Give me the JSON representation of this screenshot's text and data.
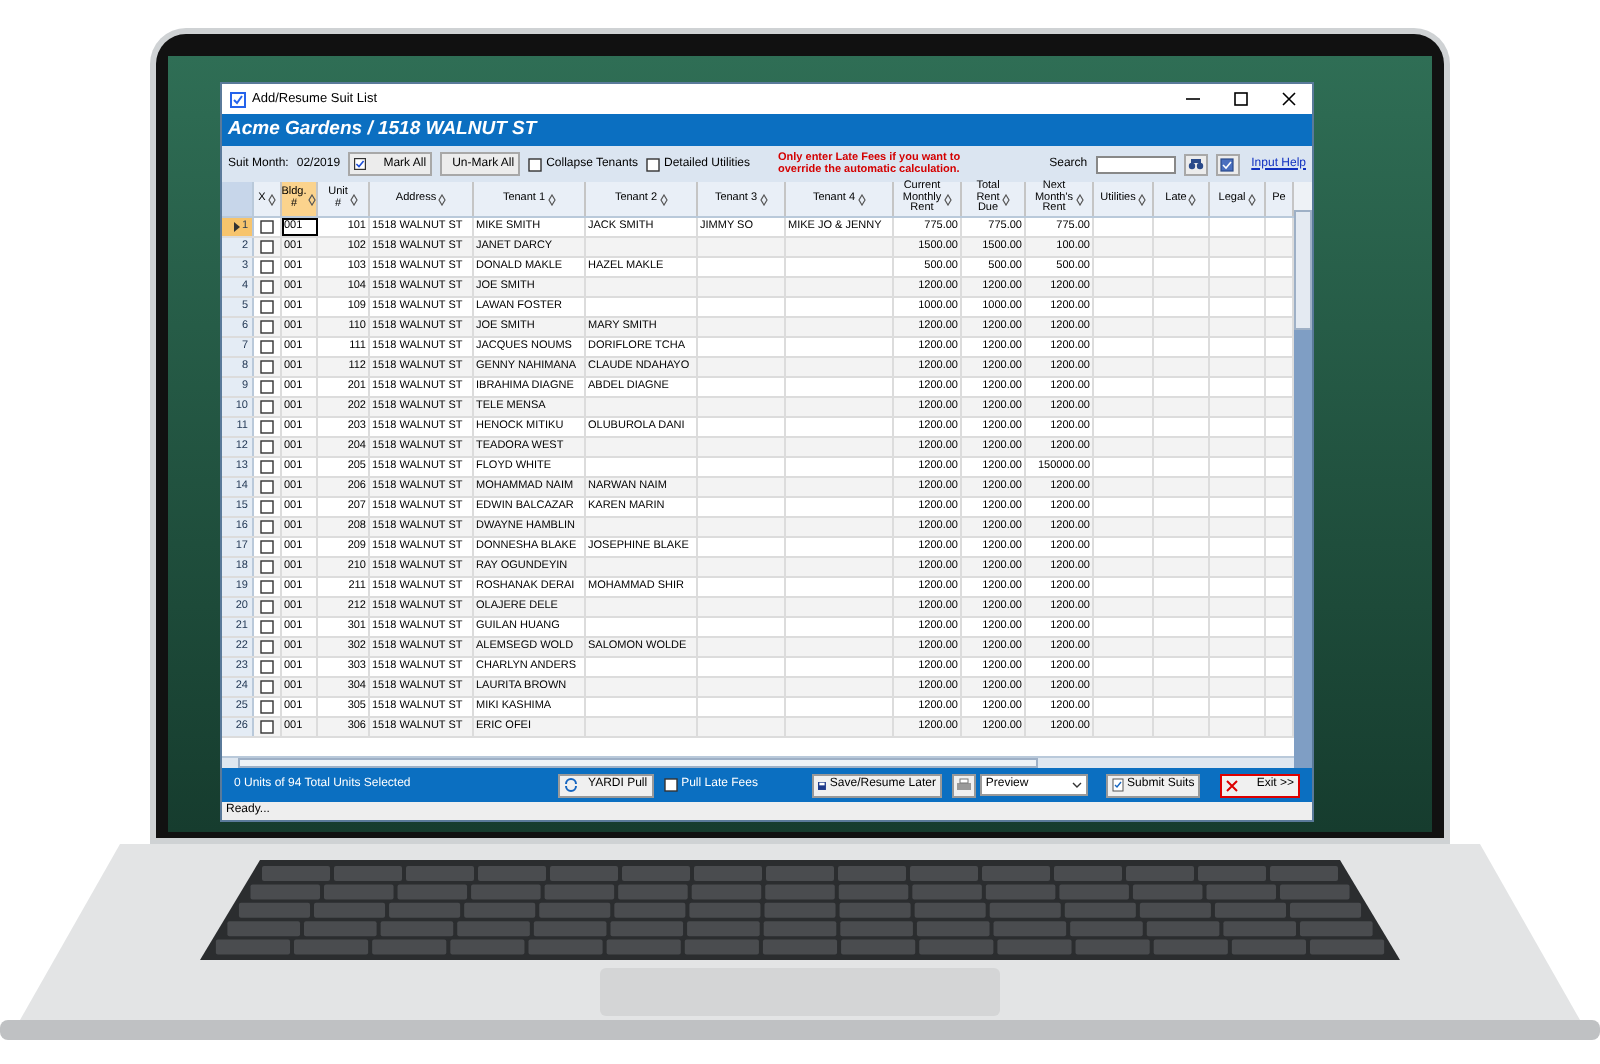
{
  "window": {
    "title": "Add/Resume Suit List"
  },
  "banner": "Acme Gardens / 1518 WALNUT ST",
  "toolbar": {
    "suit_month_label": "Suit Month:",
    "suit_month": "02/2019",
    "buttons": [
      {
        "label": "Mark All",
        "checked": true
      },
      {
        "label": "Un-Mark All",
        "checked": false
      }
    ],
    "options": [
      {
        "label": "Collapse Tenants",
        "checked": false
      },
      {
        "label": "Detailed Utilities",
        "checked": false
      }
    ],
    "notice": "Only enter Late Fees if you want to override the automatic calculation.",
    "search_label": "Search",
    "help_link": "Input Help"
  },
  "table": {
    "columns": [
      {
        "label": "X",
        "sorted": false
      },
      {
        "label": "Bldg.\n#",
        "sorted": true
      },
      {
        "label": "Unit\n#",
        "sorted": false
      },
      {
        "label": "Address",
        "sorted": false
      },
      {
        "label": "Tenant 1",
        "sorted": false
      },
      {
        "label": "Tenant 2",
        "sorted": false
      },
      {
        "label": "Tenant 3",
        "sorted": false
      },
      {
        "label": "Tenant 4",
        "sorted": false
      },
      {
        "label": "Current\nMonthly\nRent",
        "sorted": false
      },
      {
        "label": "Total\nRent\nDue",
        "sorted": false
      },
      {
        "label": "Next\nMonth's\nRent",
        "sorted": false
      },
      {
        "label": "Utilities",
        "sorted": false
      },
      {
        "label": "Late",
        "sorted": false
      },
      {
        "label": "Legal",
        "sorted": false
      },
      {
        "label": "Pe",
        "sorted": false
      }
    ],
    "rows": [
      {
        "number": "1",
        "selected": true,
        "checked": false,
        "bldg": "001",
        "unit": "101",
        "address": "1518 WALNUT ST",
        "tenants": [
          "MIKE SMITH",
          "JACK SMITH",
          "JIMMY SO",
          "MIKE JO & JENNY"
        ],
        "current_rent": "775.00",
        "total_due": "775.00",
        "next_rent": "775.00"
      },
      {
        "number": "2",
        "selected": false,
        "checked": false,
        "bldg": "001",
        "unit": "102",
        "address": "1518 WALNUT ST",
        "tenants": [
          "JANET DARCY"
        ],
        "current_rent": "1500.00",
        "total_due": "1500.00",
        "next_rent": "100.00"
      },
      {
        "number": "3",
        "selected": false,
        "checked": false,
        "bldg": "001",
        "unit": "103",
        "address": "1518 WALNUT ST",
        "tenants": [
          "DONALD MAKLE",
          "HAZEL MAKLE"
        ],
        "current_rent": "500.00",
        "total_due": "500.00",
        "next_rent": "500.00"
      },
      {
        "number": "4",
        "selected": false,
        "checked": false,
        "bldg": "001",
        "unit": "104",
        "address": "1518 WALNUT ST",
        "tenants": [
          "JOE SMITH"
        ],
        "current_rent": "1200.00",
        "total_due": "1200.00",
        "next_rent": "1200.00"
      },
      {
        "number": "5",
        "selected": false,
        "checked": false,
        "bldg": "001",
        "unit": "109",
        "address": "1518 WALNUT ST",
        "tenants": [
          "LAWAN FOSTER"
        ],
        "current_rent": "1000.00",
        "total_due": "1000.00",
        "next_rent": "1200.00"
      },
      {
        "number": "6",
        "selected": false,
        "checked": false,
        "bldg": "001",
        "unit": "110",
        "address": "1518 WALNUT ST",
        "tenants": [
          "JOE SMITH",
          "MARY SMITH"
        ],
        "current_rent": "1200.00",
        "total_due": "1200.00",
        "next_rent": "1200.00"
      },
      {
        "number": "7",
        "selected": false,
        "checked": false,
        "bldg": "001",
        "unit": "111",
        "address": "1518 WALNUT ST",
        "tenants": [
          "JACQUES NOUMS",
          "DORIFLORE TCHA"
        ],
        "current_rent": "1200.00",
        "total_due": "1200.00",
        "next_rent": "1200.00"
      },
      {
        "number": "8",
        "selected": false,
        "checked": false,
        "bldg": "001",
        "unit": "112",
        "address": "1518 WALNUT ST",
        "tenants": [
          "GENNY NAHIMANA",
          "CLAUDE NDAHAYO"
        ],
        "current_rent": "1200.00",
        "total_due": "1200.00",
        "next_rent": "1200.00"
      },
      {
        "number": "9",
        "selected": false,
        "checked": false,
        "bldg": "001",
        "unit": "201",
        "address": "1518 WALNUT ST",
        "tenants": [
          "IBRAHIMA DIAGNE",
          "ABDEL DIAGNE"
        ],
        "current_rent": "1200.00",
        "total_due": "1200.00",
        "next_rent": "1200.00"
      },
      {
        "number": "10",
        "selected": false,
        "checked": false,
        "bldg": "001",
        "unit": "202",
        "address": "1518 WALNUT ST",
        "tenants": [
          "TELE MENSA"
        ],
        "current_rent": "1200.00",
        "total_due": "1200.00",
        "next_rent": "1200.00"
      },
      {
        "number": "11",
        "selected": false,
        "checked": false,
        "bldg": "001",
        "unit": "203",
        "address": "1518 WALNUT ST",
        "tenants": [
          "HENOCK MITIKU",
          "OLUBUROLA DANI"
        ],
        "current_rent": "1200.00",
        "total_due": "1200.00",
        "next_rent": "1200.00"
      },
      {
        "number": "12",
        "selected": false,
        "checked": false,
        "bldg": "001",
        "unit": "204",
        "address": "1518 WALNUT ST",
        "tenants": [
          "TEADORA WEST"
        ],
        "current_rent": "1200.00",
        "total_due": "1200.00",
        "next_rent": "1200.00"
      },
      {
        "number": "13",
        "selected": false,
        "checked": false,
        "bldg": "001",
        "unit": "205",
        "address": "1518 WALNUT ST",
        "tenants": [
          "FLOYD WHITE"
        ],
        "current_rent": "1200.00",
        "total_due": "1200.00",
        "next_rent": "150000.00"
      },
      {
        "number": "14",
        "selected": false,
        "checked": false,
        "bldg": "001",
        "unit": "206",
        "address": "1518 WALNUT ST",
        "tenants": [
          "MOHAMMAD NAIM",
          "NARWAN NAIM"
        ],
        "current_rent": "1200.00",
        "total_due": "1200.00",
        "next_rent": "1200.00"
      },
      {
        "number": "15",
        "selected": false,
        "checked": false,
        "bldg": "001",
        "unit": "207",
        "address": "1518 WALNUT ST",
        "tenants": [
          "EDWIN BALCAZAR",
          "KAREN MARIN"
        ],
        "current_rent": "1200.00",
        "total_due": "1200.00",
        "next_rent": "1200.00"
      },
      {
        "number": "16",
        "selected": false,
        "checked": false,
        "bldg": "001",
        "unit": "208",
        "address": "1518 WALNUT ST",
        "tenants": [
          "DWAYNE HAMBLIN"
        ],
        "current_rent": "1200.00",
        "total_due": "1200.00",
        "next_rent": "1200.00"
      },
      {
        "number": "17",
        "selected": false,
        "checked": false,
        "bldg": "001",
        "unit": "209",
        "address": "1518 WALNUT ST",
        "tenants": [
          "DONNESHA BLAKE",
          "JOSEPHINE BLAKE"
        ],
        "current_rent": "1200.00",
        "total_due": "1200.00",
        "next_rent": "1200.00"
      },
      {
        "number": "18",
        "selected": false,
        "checked": false,
        "bldg": "001",
        "unit": "210",
        "address": "1518 WALNUT ST",
        "tenants": [
          "RAY OGUNDEYIN"
        ],
        "current_rent": "1200.00",
        "total_due": "1200.00",
        "next_rent": "1200.00"
      },
      {
        "number": "19",
        "selected": false,
        "checked": false,
        "bldg": "001",
        "unit": "211",
        "address": "1518 WALNUT ST",
        "tenants": [
          "ROSHANAK DERAI",
          "MOHAMMAD SHIR"
        ],
        "current_rent": "1200.00",
        "total_due": "1200.00",
        "next_rent": "1200.00"
      },
      {
        "number": "20",
        "selected": false,
        "checked": false,
        "bldg": "001",
        "unit": "212",
        "address": "1518 WALNUT ST",
        "tenants": [
          "OLAJERE DELE"
        ],
        "current_rent": "1200.00",
        "total_due": "1200.00",
        "next_rent": "1200.00"
      },
      {
        "number": "21",
        "selected": false,
        "checked": false,
        "bldg": "001",
        "unit": "301",
        "address": "1518 WALNUT ST",
        "tenants": [
          "GUILAN HUANG"
        ],
        "current_rent": "1200.00",
        "total_due": "1200.00",
        "next_rent": "1200.00"
      },
      {
        "number": "22",
        "selected": false,
        "checked": false,
        "bldg": "001",
        "unit": "302",
        "address": "1518 WALNUT ST",
        "tenants": [
          "ALEMSEGD WOLD",
          "SALOMON WOLDE"
        ],
        "current_rent": "1200.00",
        "total_due": "1200.00",
        "next_rent": "1200.00"
      },
      {
        "number": "23",
        "selected": false,
        "checked": false,
        "bldg": "001",
        "unit": "303",
        "address": "1518 WALNUT ST",
        "tenants": [
          "CHARLYN ANDERS"
        ],
        "current_rent": "1200.00",
        "total_due": "1200.00",
        "next_rent": "1200.00"
      },
      {
        "number": "24",
        "selected": false,
        "checked": false,
        "bldg": "001",
        "unit": "304",
        "address": "1518 WALNUT ST",
        "tenants": [
          "LAURITA BROWN"
        ],
        "current_rent": "1200.00",
        "total_due": "1200.00",
        "next_rent": "1200.00"
      },
      {
        "number": "25",
        "selected": false,
        "checked": false,
        "bldg": "001",
        "unit": "305",
        "address": "1518 WALNUT ST",
        "tenants": [
          "MIKI KASHIMA"
        ],
        "current_rent": "1200.00",
        "total_due": "1200.00",
        "next_rent": "1200.00"
      },
      {
        "number": "26",
        "selected": false,
        "checked": false,
        "bldg": "001",
        "unit": "306",
        "address": "1518 WALNUT ST",
        "tenants": [
          "ERIC OFEI"
        ],
        "current_rent": "1200.00",
        "total_due": "1200.00",
        "next_rent": "1200.00"
      }
    ]
  },
  "footer": {
    "selection": "0 Units of 94 Total Units Selected",
    "yardi_button": "YARDI Pull",
    "pull_late_fees": {
      "label": "Pull Late Fees",
      "checked": false
    },
    "save_button": "Save/Resume Later",
    "preview": "Preview",
    "submit_button": "Submit Suits",
    "exit_button": "Exit >>"
  },
  "status": "Ready..."
}
